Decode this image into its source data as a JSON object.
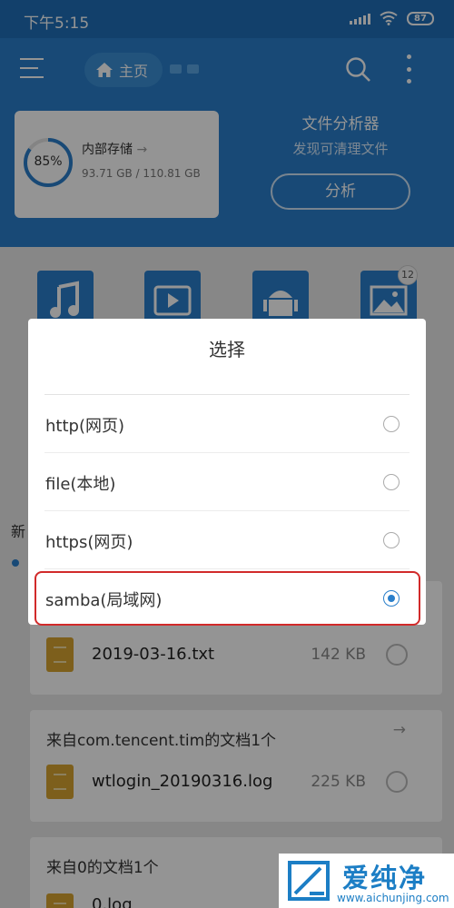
{
  "status_bar": {
    "time": "下午5:15",
    "battery": "87"
  },
  "toolbar": {
    "breadcrumb_home": "主页"
  },
  "storage": {
    "percent": "85%",
    "percent_value": 85,
    "name": "内部存储",
    "size": "93.71 GB / 110.81 GB"
  },
  "analyzer": {
    "title": "文件分析器",
    "subtitle": "发现可清理文件",
    "button": "分析"
  },
  "categories": {
    "badge": "12",
    "icons": [
      "music-icon",
      "video-icon",
      "android-icon",
      "image-icon"
    ]
  },
  "recent": {
    "label": "新"
  },
  "cards": [
    {
      "title": "",
      "file_name": "2019-03-16.txt",
      "file_size": "142 KB"
    },
    {
      "title": "来自com.tencent.tim的文档1个",
      "file_name": "wtlogin_20190316.log",
      "file_size": "225 KB"
    },
    {
      "title": "来自0的文档1个",
      "file_name": "0.log",
      "file_size": ""
    }
  ],
  "dialog": {
    "title": "选择",
    "options": [
      {
        "label": "http(网页)",
        "checked": false
      },
      {
        "label": "file(本地)",
        "checked": false
      },
      {
        "label": "https(网页)",
        "checked": false
      },
      {
        "label": "samba(局域网)",
        "checked": true
      }
    ]
  },
  "watermark": {
    "text": "爱纯净",
    "url": "www.aichunjing.com"
  },
  "colors": {
    "primary": "#2a7fcb",
    "highlight": "#d12a2a",
    "file_icon": "#d7a431"
  }
}
